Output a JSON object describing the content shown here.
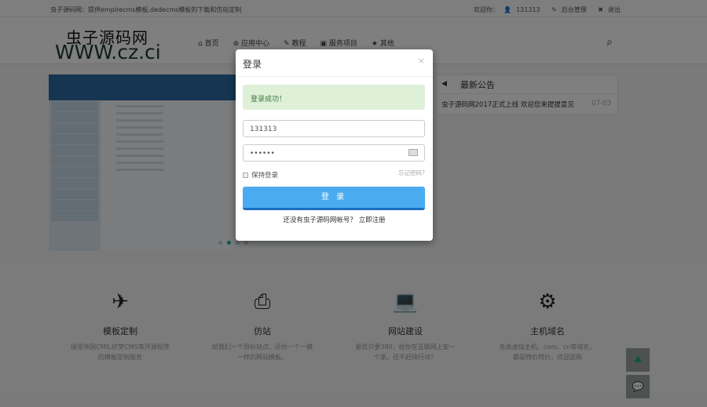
{
  "topbar": {
    "tagline": "虫子源码网：提供empirecms模板,dedecms模板的下载和仿站定制",
    "welcome": "欢迎你：",
    "username": "131313",
    "admin": "后台管理",
    "logout": "退出"
  },
  "header": {
    "logo_cn": "虫子源码网",
    "logo_en": "WWW.cz.ci",
    "nav": [
      "首页",
      "应用中心",
      "教程",
      "服务项目",
      "其他"
    ]
  },
  "notice": {
    "title": "最新公告",
    "items": [
      {
        "text": "虫子源码网2017正式上线 欢迎您来提提意见",
        "date": "07-03"
      }
    ]
  },
  "features": [
    {
      "title": "模板定制",
      "desc": "接受帝国CMS,织梦CMS等开源程序的模板定制服务"
    },
    {
      "title": "仿站",
      "desc": "给我们一个目标站点，还你一个一模一样的网站模板。"
    },
    {
      "title": "网站建设",
      "desc": "最低只要380，给你在互联网上安一个家。还不赶快行动？"
    },
    {
      "title": "主机域名",
      "desc": "各类虚拟主机、com、cn等域名，都是特价特价，欢迎选购"
    }
  ],
  "modal": {
    "title": "登录",
    "close": "×",
    "alert": "登录成功！",
    "username_value": "131313",
    "password_value": "••••••",
    "remember": "保持登录",
    "forgot": "忘记密码?",
    "submit": "登 录",
    "register_prompt": "还没有虫子源码网帐号？ 立即注册"
  }
}
